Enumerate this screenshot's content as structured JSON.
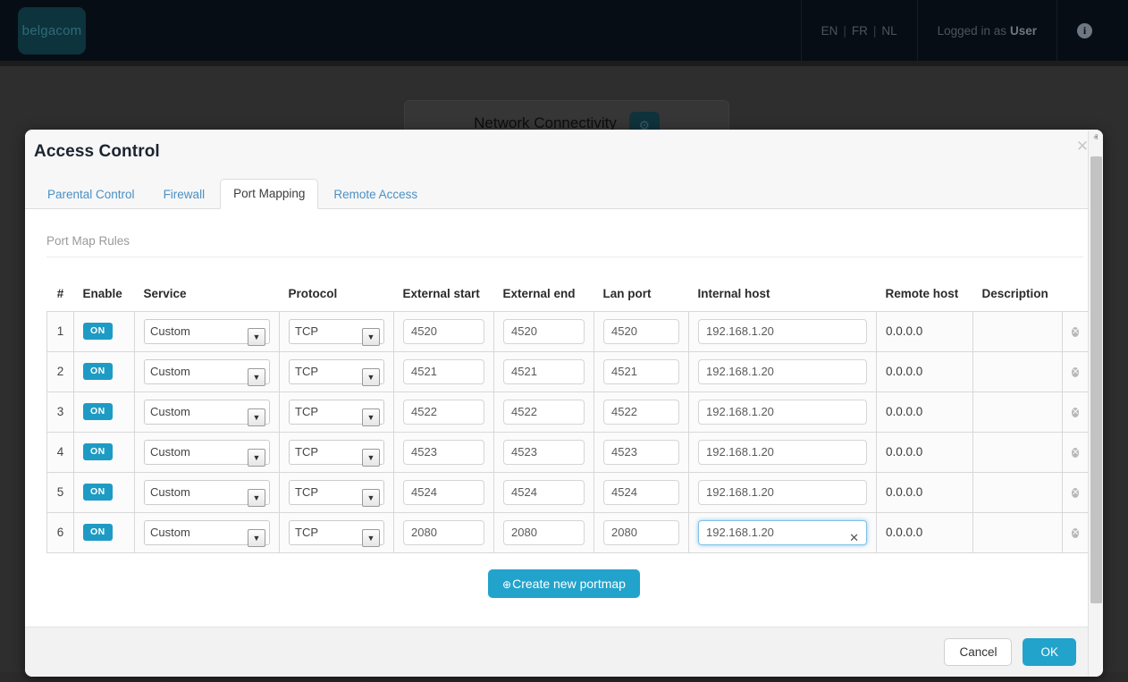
{
  "topbar": {
    "logo_text": "belgacom",
    "languages": [
      "EN",
      "FR",
      "NL"
    ],
    "lang_separator": "|",
    "logged_in_prefix": "Logged in as",
    "logged_in_user": "User",
    "info_icon": "info-icon",
    "info_glyph": "i"
  },
  "background": {
    "card_title": "Network Connectivity",
    "card_gear_icon": "gear-icon",
    "gear_glyph": "⚙"
  },
  "modal": {
    "title": "Access Control",
    "close_glyph": "✕",
    "tabs": [
      {
        "label": "Parental Control",
        "active": false
      },
      {
        "label": "Firewall",
        "active": false
      },
      {
        "label": "Port Mapping",
        "active": true
      },
      {
        "label": "Remote Access",
        "active": false
      }
    ],
    "section_label": "Port Map Rules",
    "create_button": {
      "glyph": "⊕",
      "label": "Create new portmap"
    },
    "footer": {
      "cancel_label": "Cancel",
      "ok_label": "OK"
    },
    "scrollbar": {
      "up_glyph": "ⱏ",
      "down_glyph": "ⱟ"
    }
  },
  "table": {
    "headers": [
      "#",
      "Enable",
      "Service",
      "Protocol",
      "External start",
      "External end",
      "Lan port",
      "Internal host",
      "Remote host",
      "Description",
      ""
    ],
    "toggle_label": "ON",
    "delete_glyph": "✕",
    "clear_glyph": "✕",
    "rows": [
      {
        "num": "1",
        "enable": "ON",
        "service": "Custom",
        "protocol": "TCP",
        "external_start": "4520",
        "external_end": "4520",
        "lan_port": "4520",
        "internal_host": "192.168.1.20",
        "remote_host": "0.0.0.0",
        "description": "",
        "focused": false
      },
      {
        "num": "2",
        "enable": "ON",
        "service": "Custom",
        "protocol": "TCP",
        "external_start": "4521",
        "external_end": "4521",
        "lan_port": "4521",
        "internal_host": "192.168.1.20",
        "remote_host": "0.0.0.0",
        "description": "",
        "focused": false
      },
      {
        "num": "3",
        "enable": "ON",
        "service": "Custom",
        "protocol": "TCP",
        "external_start": "4522",
        "external_end": "4522",
        "lan_port": "4522",
        "internal_host": "192.168.1.20",
        "remote_host": "0.0.0.0",
        "description": "",
        "focused": false
      },
      {
        "num": "4",
        "enable": "ON",
        "service": "Custom",
        "protocol": "TCP",
        "external_start": "4523",
        "external_end": "4523",
        "lan_port": "4523",
        "internal_host": "192.168.1.20",
        "remote_host": "0.0.0.0",
        "description": "",
        "focused": false
      },
      {
        "num": "5",
        "enable": "ON",
        "service": "Custom",
        "protocol": "TCP",
        "external_start": "4524",
        "external_end": "4524",
        "lan_port": "4524",
        "internal_host": "192.168.1.20",
        "remote_host": "0.0.0.0",
        "description": "",
        "focused": false
      },
      {
        "num": "6",
        "enable": "ON",
        "service": "Custom",
        "protocol": "TCP",
        "external_start": "2080",
        "external_end": "2080",
        "lan_port": "2080",
        "internal_host": "192.168.1.20",
        "remote_host": "0.0.0.0",
        "description": "",
        "focused": true
      }
    ]
  },
  "colors": {
    "accent": "#22a3cc",
    "toggle_on": "#1e9bc4",
    "tab_link": "#4a90c4",
    "topbar_bg": "#070d14",
    "overlay_bg": "#2e2e2e"
  }
}
